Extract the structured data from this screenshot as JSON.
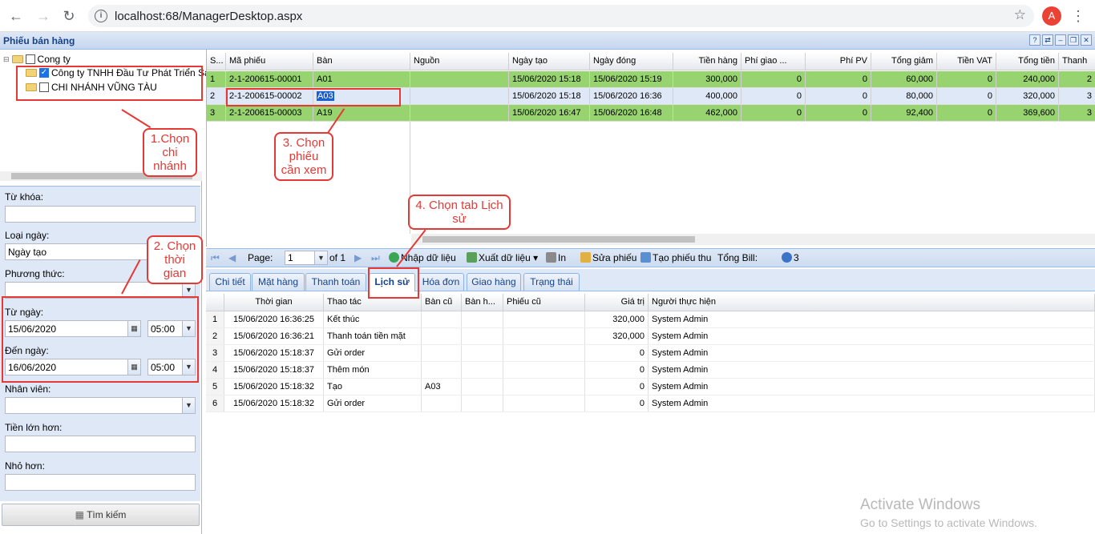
{
  "browser": {
    "url": "localhost:68/ManagerDesktop.aspx",
    "avatar_letter": "A"
  },
  "window": {
    "title": "Phiếu bán hàng"
  },
  "tree": {
    "root": "Cong ty",
    "nodes": [
      {
        "label": "Công ty TNHH Đầu Tư Phát Triển Sài",
        "checked": true
      },
      {
        "label": "CHI NHÁNH VŨNG TÀU",
        "checked": false
      }
    ]
  },
  "filters": {
    "keyword_label": "Từ khóa:",
    "keyword_value": "",
    "date_type_label": "Loại ngày:",
    "date_type_value": "Ngày tạo",
    "method_label": "Phương thức:",
    "method_value": "",
    "from_label": "Từ ngày:",
    "from_date": "15/06/2020",
    "from_time": "05:00",
    "to_label": "Đến ngày:",
    "to_date": "16/06/2020",
    "to_time": "05:00",
    "staff_label": "Nhân viên:",
    "staff_value": "",
    "more_than_label": "Tiền lớn hơn:",
    "more_than_value": "",
    "less_than_label": "Nhỏ hơn:",
    "less_than_value": "",
    "search_button": "Tìm kiếm"
  },
  "grid": {
    "columns": [
      "S...",
      "Mã phiếu",
      "Bàn",
      "Nguồn",
      "Ngày tạo",
      "Ngày đóng",
      "Tiền hàng",
      "Phí giao ...",
      "Phí PV",
      "Tổng giảm",
      "Tiền VAT",
      "Tổng tiền",
      "Thanh"
    ],
    "rows": [
      {
        "stt": "1",
        "code": "2-1-200615-00001",
        "table": "A01",
        "source": "",
        "created": "15/06/2020 15:18",
        "closed": "15/06/2020 15:19",
        "goods": "300,000",
        "ship": "0",
        "service": "0",
        "discount": "60,000",
        "vat": "0",
        "total": "240,000",
        "paid": "2"
      },
      {
        "stt": "2",
        "code": "2-1-200615-00002",
        "table": "A03",
        "source": "",
        "created": "15/06/2020 15:18",
        "closed": "15/06/2020 16:36",
        "goods": "400,000",
        "ship": "0",
        "service": "0",
        "discount": "80,000",
        "vat": "0",
        "total": "320,000",
        "paid": "3"
      },
      {
        "stt": "3",
        "code": "2-1-200615-00003",
        "table": "A19",
        "source": "",
        "created": "15/06/2020 16:47",
        "closed": "15/06/2020 16:48",
        "goods": "462,000",
        "ship": "0",
        "service": "0",
        "discount": "92,400",
        "vat": "0",
        "total": "369,600",
        "paid": "3"
      }
    ]
  },
  "paging": {
    "page_label": "Page:",
    "page_value": "1",
    "of_label": "of 1",
    "import": "Nhập dữ liệu",
    "export": "Xuất dữ liệu",
    "print": "In",
    "edit": "Sửa phiếu",
    "receipt": "Tạo phiếu thu",
    "total_bill_label": "Tổng Bill:",
    "total_bill_value": "3"
  },
  "tabs": [
    "Chi tiết",
    "Mặt hàng",
    "Thanh toán",
    "Lịch sử",
    "Hóa đơn",
    "Giao hàng",
    "Trạng thái"
  ],
  "history": {
    "columns": [
      "Thời gian",
      "Thao tác",
      "Bàn cũ",
      "Bàn h...",
      "Phiếu cũ",
      "Giá trị",
      "Người thực hiện"
    ],
    "rows": [
      {
        "n": "1",
        "time": "15/06/2020 16:36:25",
        "action": "Kết thúc",
        "old_table": "",
        "new_table": "",
        "old_bill": "",
        "value": "320,000",
        "user": "System Admin"
      },
      {
        "n": "2",
        "time": "15/06/2020 16:36:21",
        "action": "Thanh toán tiền mặt",
        "old_table": "",
        "new_table": "",
        "old_bill": "",
        "value": "320,000",
        "user": "System Admin"
      },
      {
        "n": "3",
        "time": "15/06/2020 15:18:37",
        "action": "Gửi order",
        "old_table": "",
        "new_table": "",
        "old_bill": "",
        "value": "0",
        "user": "System Admin"
      },
      {
        "n": "4",
        "time": "15/06/2020 15:18:37",
        "action": "Thêm món",
        "old_table": "",
        "new_table": "",
        "old_bill": "",
        "value": "0",
        "user": "System Admin"
      },
      {
        "n": "5",
        "time": "15/06/2020 15:18:32",
        "action": "Tạo",
        "old_table": "A03",
        "new_table": "",
        "old_bill": "",
        "value": "0",
        "user": "System Admin"
      },
      {
        "n": "6",
        "time": "15/06/2020 15:18:32",
        "action": "Gửi order",
        "old_table": "",
        "new_table": "",
        "old_bill": "",
        "value": "0",
        "user": "System Admin"
      }
    ]
  },
  "annotations": {
    "step1": "1.Chọn chi nhánh",
    "step2": "2. Chọn thời gian",
    "step3": "3. Chọn phiếu cần xem",
    "step4": "4. Chọn tab Lịch sử"
  },
  "watermark": {
    "title": "Activate Windows",
    "subtitle": "Go to Settings to activate Windows."
  },
  "colors": {
    "selected_row": "#97d36e",
    "annotation": "#e53935",
    "panel": "#dfe8f6"
  }
}
